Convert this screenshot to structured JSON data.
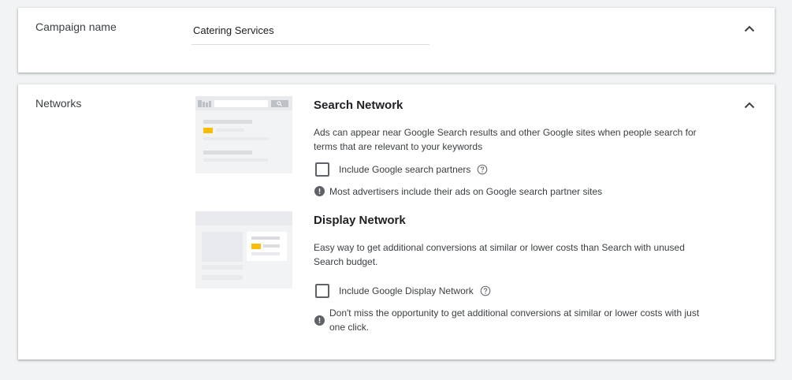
{
  "campaign": {
    "label": "Campaign name",
    "value": "Catering Services"
  },
  "networks": {
    "label": "Networks",
    "search": {
      "title": "Search Network",
      "description": "Ads can appear near Google Search results and other Google sites when people search for terms that are relevant to your keywords",
      "checkbox_label": "Include Google search partners",
      "note": "Most advertisers include their ads on Google search partner sites"
    },
    "display": {
      "title": "Display Network",
      "description": "Easy way to get additional conversions at similar or lower costs than Search with unused Search budget.",
      "checkbox_label": "Include Google Display Network",
      "note": "Don't miss the opportunity to get additional conversions at similar or lower costs with just one click."
    }
  },
  "colors": {
    "accent_yellow": "#fbbc04",
    "placeholder_gray": "#dadce0",
    "thumb_bg": "#f1f3f4",
    "text": "#3c4043"
  },
  "icons": [
    "chevron-up-icon",
    "help-circle-icon",
    "info-icon",
    "search-icon"
  ]
}
